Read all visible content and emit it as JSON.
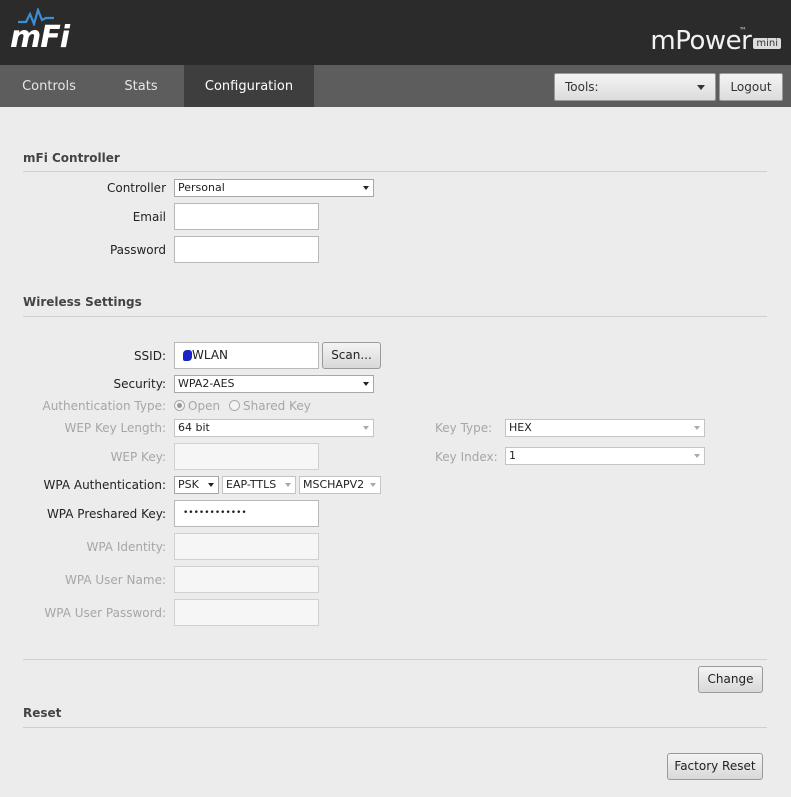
{
  "header": {
    "logo_text": "mFi",
    "brand_name": "mPower",
    "brand_tm": "™",
    "brand_badge": "mini"
  },
  "nav": {
    "tabs": [
      {
        "label": "Controls"
      },
      {
        "label": "Stats"
      },
      {
        "label": "Configuration"
      }
    ],
    "tools_label": "Tools:",
    "logout_label": "Logout"
  },
  "controller_section": {
    "title": "mFi Controller",
    "controller_label": "Controller",
    "controller_value": "Personal",
    "email_label": "Email",
    "email_value": "",
    "password_label": "Password",
    "password_value": ""
  },
  "wireless_section": {
    "title": "Wireless Settings",
    "ssid_label": "SSID:",
    "ssid_value": "WLAN",
    "scan_label": "Scan...",
    "security_label": "Security:",
    "security_value": "WPA2-AES",
    "auth_type_label": "Authentication Type:",
    "auth_open_label": "Open",
    "auth_shared_label": "Shared Key",
    "wep_key_length_label": "WEP Key Length:",
    "wep_key_length_value": "64 bit",
    "key_type_label": "Key Type:",
    "key_type_value": "HEX",
    "wep_key_label": "WEP Key:",
    "key_index_label": "Key Index:",
    "key_index_value": "1",
    "wpa_auth_label": "WPA Authentication:",
    "wpa_auth_psk": "PSK",
    "wpa_auth_eap": "EAP-TTLS",
    "wpa_auth_inner": "MSCHAPV2",
    "wpa_psk_label": "WPA Preshared Key:",
    "wpa_psk_value": "••••••••••••",
    "wpa_identity_label": "WPA Identity:",
    "wpa_user_name_label": "WPA User Name:",
    "wpa_user_password_label": "WPA User Password:",
    "change_label": "Change"
  },
  "reset_section": {
    "title": "Reset",
    "factory_reset_label": "Factory Reset"
  }
}
